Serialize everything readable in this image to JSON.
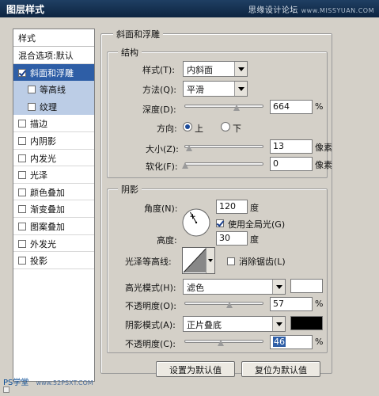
{
  "window": {
    "title": "图层样式",
    "watermark_cn": "思缘设计论坛",
    "watermark_url": "www.MISSYUAN.COM"
  },
  "sidebar": {
    "header": "样式",
    "items": [
      {
        "label": "混合选项:默认",
        "checkbox": false
      },
      {
        "label": "斜面和浮雕",
        "checkbox": true,
        "checked": true,
        "selected": true
      },
      {
        "label": "等高线",
        "checkbox": true,
        "checked": false,
        "sub": true
      },
      {
        "label": "纹理",
        "checkbox": true,
        "checked": false,
        "sub": true
      },
      {
        "label": "描边",
        "checkbox": true,
        "checked": false
      },
      {
        "label": "内阴影",
        "checkbox": true,
        "checked": false
      },
      {
        "label": "内发光",
        "checkbox": true,
        "checked": false
      },
      {
        "label": "光泽",
        "checkbox": true,
        "checked": false
      },
      {
        "label": "颜色叠加",
        "checkbox": true,
        "checked": false
      },
      {
        "label": "渐变叠加",
        "checkbox": true,
        "checked": false
      },
      {
        "label": "图案叠加",
        "checkbox": true,
        "checked": false
      },
      {
        "label": "外发光",
        "checkbox": true,
        "checked": false
      },
      {
        "label": "投影",
        "checkbox": true,
        "checked": false
      }
    ]
  },
  "bevel": {
    "title": "斜面和浮雕",
    "structure": {
      "title": "结构",
      "style_label": "样式(T):",
      "style_value": "内斜面",
      "method_label": "方法(Q):",
      "method_value": "平滑",
      "depth_label": "深度(D):",
      "depth_value": "664",
      "depth_unit": "%",
      "depth_fraction": 0.664,
      "direction_label": "方向:",
      "direction_up": "上",
      "direction_down": "下",
      "direction_selected": "up",
      "size_label": "大小(Z):",
      "size_value": "13",
      "size_unit": "像素",
      "size_fraction": 0.05,
      "soften_label": "软化(F):",
      "soften_value": "0",
      "soften_unit": "像素",
      "soften_fraction": 0.0
    },
    "shading": {
      "title": "阴影",
      "angle_label": "角度(N):",
      "angle_value": "120",
      "angle_unit": "度",
      "global_light_label": "使用全局光(G)",
      "global_light_checked": true,
      "altitude_label": "高度:",
      "altitude_value": "30",
      "altitude_unit": "度",
      "gloss_label": "光泽等高线:",
      "anti_alias_label": "消除锯齿(L)",
      "anti_alias_checked": false,
      "highlight_mode_label": "高光模式(H):",
      "highlight_mode_value": "滤色",
      "highlight_color": "#ffffff",
      "highlight_opacity_label": "不透明度(O):",
      "highlight_opacity_value": "57",
      "highlight_opacity_unit": "%",
      "highlight_opacity_fraction": 0.57,
      "shadow_mode_label": "阴影模式(A):",
      "shadow_mode_value": "正片叠底",
      "shadow_color": "#000000",
      "shadow_opacity_label": "不透明度(C):",
      "shadow_opacity_value": "46",
      "shadow_opacity_unit": "%",
      "shadow_opacity_fraction": 0.46
    },
    "make_default_button": "设置为默认值",
    "reset_default_button": "复位为默认值"
  },
  "footer_watermark": {
    "text": "PS学堂",
    "url": "www.52PSXT.COM"
  },
  "colors": {
    "selection": "#2e5ea6",
    "sub_row": "#bccde6",
    "dialog_bg": "#d4d0c8",
    "title_bar": "#1f3f63"
  }
}
